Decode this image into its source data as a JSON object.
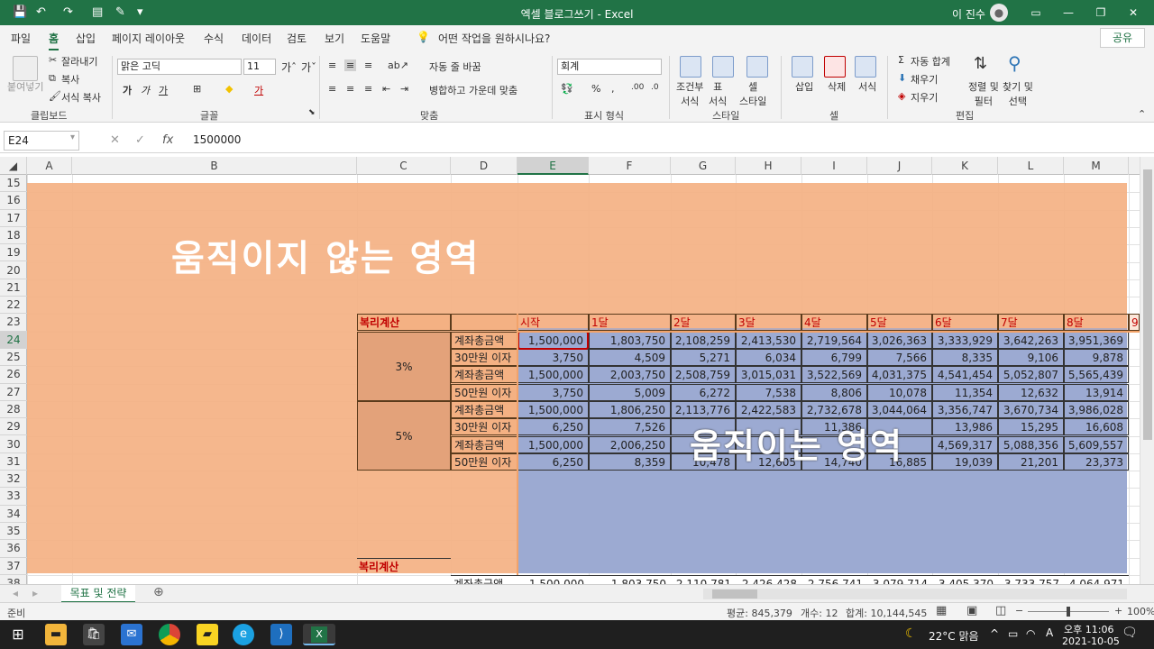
{
  "window": {
    "title": "엑셀 블로그쓰기  -  Excel",
    "user": "이 진수"
  },
  "menu": {
    "tabs": [
      "파일",
      "홈",
      "삽입",
      "페이지 레이아웃",
      "수식",
      "데이터",
      "검토",
      "보기",
      "도움말"
    ],
    "tell_me": "어떤 작업을 원하시나요?",
    "share": "공유"
  },
  "ribbon": {
    "paste": "붙여넣기",
    "cut": "잘라내기",
    "copy": "복사",
    "format_painter": "서식 복사",
    "clipboard": "클립보드",
    "font_name": "맑은 고딕",
    "font_size": "11",
    "font": "글꼴",
    "wrap_text": "자동 줄 바꿈",
    "merge_center": "병합하고 가운데 맞춤",
    "alignment": "맞춤",
    "number_format": "회계",
    "number": "표시 형식",
    "conditional": "조건부\n서식",
    "format_table": "표\n서식",
    "cell_style": "셀\n스타일",
    "styles": "스타일",
    "insert": "삽입",
    "delete": "삭제",
    "format": "서식",
    "cells": "셀",
    "autosum": "자동 합계",
    "fill": "채우기",
    "clear": "지우기",
    "sort_filter": "정렬 및\n필터",
    "find_select": "찾기 및\n선택",
    "editing": "편집"
  },
  "formula_bar": {
    "name_box": "E24",
    "value": "1500000"
  },
  "columns": [
    "A",
    "B",
    "C",
    "D",
    "E",
    "F",
    "G",
    "H",
    "I",
    "J",
    "K",
    "L",
    "M"
  ],
  "rows": [
    "15",
    "16",
    "17",
    "18",
    "19",
    "20",
    "21",
    "22",
    "23",
    "24",
    "25",
    "26",
    "27",
    "28",
    "29",
    "30",
    "31",
    "32",
    "33",
    "34",
    "35",
    "36",
    "37",
    "38"
  ],
  "sheet": {
    "label_fixed": "움직이지 않는 영역",
    "label_moving": "움직이는 영역",
    "block_title": "복리계산",
    "block_title_2": "복리계산",
    "rate_3": "3%",
    "rate_5": "5%",
    "header_row": [
      "시작",
      "1달",
      "2달",
      "3달",
      "4달",
      "5달",
      "6달",
      "7달",
      "8달",
      "9"
    ],
    "data_rows": [
      {
        "label": "계좌총금액",
        "values": [
          "1,500,000",
          "1,803,750",
          "2,108,259",
          "2,413,530",
          "2,719,564",
          "3,026,363",
          "3,333,929",
          "3,642,263",
          "3,951,369"
        ]
      },
      {
        "label": "30만원 이자",
        "values": [
          "3,750",
          "4,509",
          "5,271",
          "6,034",
          "6,799",
          "7,566",
          "8,335",
          "9,106",
          "9,878"
        ]
      },
      {
        "label": "계좌총금액",
        "values": [
          "1,500,000",
          "2,003,750",
          "2,508,759",
          "3,015,031",
          "3,522,569",
          "4,031,375",
          "4,541,454",
          "5,052,807",
          "5,565,439"
        ]
      },
      {
        "label": "50만원 이자",
        "values": [
          "3,750",
          "5,009",
          "6,272",
          "7,538",
          "8,806",
          "10,078",
          "11,354",
          "12,632",
          "13,914"
        ]
      },
      {
        "label": "계좌총금액",
        "values": [
          "1,500,000",
          "1,806,250",
          "2,113,776",
          "2,422,583",
          "2,732,678",
          "3,044,064",
          "3,356,747",
          "3,670,734",
          "3,986,028"
        ]
      },
      {
        "label": "30만원 이자",
        "values": [
          "6,250",
          "7,526",
          "",
          "",
          "11,386",
          "",
          "13,986",
          "15,295",
          "16,608"
        ]
      },
      {
        "label": "계좌총금액",
        "values": [
          "1,500,000",
          "2,006,250",
          "",
          "",
          "",
          "",
          "4,569,317",
          "5,088,356",
          "5,609,557"
        ]
      },
      {
        "label": "50만원 이자",
        "values": [
          "6,250",
          "8,359",
          "10,478",
          "12,605",
          "14,740",
          "16,885",
          "19,039",
          "21,201",
          "23,373"
        ]
      }
    ],
    "row_38_partial": {
      "label": "계좌총금액",
      "values": [
        "1,500,000",
        "1,803,750",
        "2,110,781",
        "2,426,428",
        "2,756,741",
        "3,079,714",
        "3,405,370",
        "3,733,757",
        "4,064,971"
      ]
    }
  },
  "sheet_tabs": [
    "목표 및 전략"
  ],
  "status": {
    "ready": "준비",
    "average": "평균: 845,379",
    "count": "개수: 12",
    "sum": "합계: 10,144,545",
    "zoom": "100%"
  },
  "taskbar": {
    "weather": "22°C  맑음",
    "ime": "A",
    "time": "오후 11:06",
    "date": "2021-10-05"
  },
  "colors": {
    "excel_green": "#217346",
    "fixed_area": "#f4b183",
    "moving_area": "#8fa9dc",
    "header_red": "#c00000"
  }
}
